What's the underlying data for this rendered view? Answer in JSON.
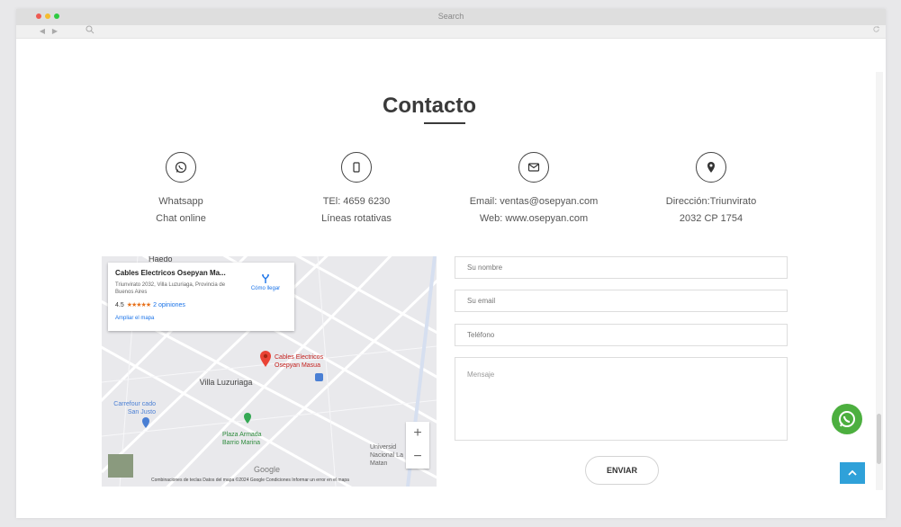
{
  "browser": {
    "title": "Search",
    "nav": {
      "back": "◀",
      "forward": "▶"
    },
    "icons": {
      "search": "search-icon",
      "refresh": "refresh-icon"
    }
  },
  "page": {
    "heading": "Contacto",
    "info": [
      {
        "icon": "whatsapp-icon",
        "line1": "Whatsapp",
        "line2": "Chat online"
      },
      {
        "icon": "phone-icon",
        "line1": "TEl: 4659 6230",
        "line2": "Líneas rotativas"
      },
      {
        "icon": "mail-icon",
        "line1": "Email: ventas@osepyan.com",
        "line2": "Web: www.osepyan.com"
      },
      {
        "icon": "location-icon",
        "line1": "Dirección:Triunvirato",
        "line2": "2032 CP 1754"
      }
    ]
  },
  "map": {
    "place_name": "Cables Electricos Osepyan Ma...",
    "address": "Triunvirato 2032, Villa Luzuriaga, Provincia de Buenos Aires",
    "rating": "4.5",
    "stars": "★★★★★",
    "reviews": "2 opiniones",
    "directions": "Cómo llegar",
    "enlarge": "Ampliar el mapa",
    "marker_label": "Cables Electricos Osepyan Masua",
    "labels": {
      "haedo": "Haedo",
      "villa": "Villa Luzuriaga",
      "carrefour": "Carrefour cado San Justo",
      "plaza": "Plaza Armada Barrio Marina",
      "univ": "Universid Nacional La Matan",
      "google": "Google"
    },
    "zoom_in": "+",
    "zoom_out": "−",
    "footer": "Combinaciones de teclas   Datos del mapa ©2024 Google   Condiciones   Informar un error en el mapa"
  },
  "form": {
    "name_placeholder": "Su nombre",
    "email_placeholder": "Su email",
    "phone_placeholder": "Teléfono",
    "message_placeholder": "Mensaje",
    "submit": "ENVIAR"
  },
  "colors": {
    "whatsapp": "#4caf3f",
    "scroll_top": "#2fa1d9",
    "marker": "#ea4335"
  }
}
